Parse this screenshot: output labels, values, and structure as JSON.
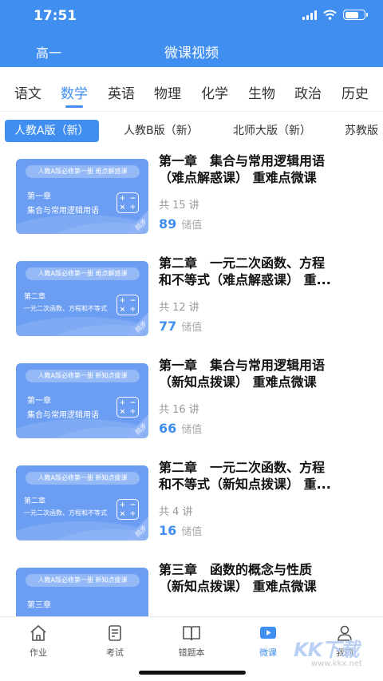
{
  "status": {
    "time": "17:51"
  },
  "header": {
    "grade": "高一",
    "title": "微课视频"
  },
  "subjects": [
    "语文",
    "数学",
    "英语",
    "物理",
    "化学",
    "生物",
    "政治",
    "历史"
  ],
  "active_subject": "数学",
  "editions": [
    "人教A版（新）",
    "人教B版（新）",
    "北师大版（新）",
    "苏教版"
  ],
  "active_edition": "人教A版（新）",
  "courses": [
    {
      "thumb_header": "人教A版必修第一册   难点解惑课",
      "thumb_chapter": "第一章",
      "thumb_topic": "集合与常用逻辑用语",
      "title_line1": "第一章　集合与常用逻辑用语",
      "title_line2": "（难点解惑课） 重难点微课",
      "count": "共 15 讲",
      "price": "89",
      "price_unit": "储值"
    },
    {
      "thumb_header": "人教A版必修第一册   难点解惑课",
      "thumb_chapter": "第二章",
      "thumb_topic": "一元二次函数、方程和不等式",
      "title_line1": "第二章　一元二次函数、方程",
      "title_line2": "和不等式（难点解惑课） 重...",
      "count": "共 12 讲",
      "price": "77",
      "price_unit": "储值"
    },
    {
      "thumb_header": "人教A版必修第一册   新知点拨课",
      "thumb_chapter": "第一章",
      "thumb_topic": "集合与常用逻辑用语",
      "title_line1": "第一章　集合与常用逻辑用语",
      "title_line2": "（新知点拨课） 重难点微课",
      "count": "共 16 讲",
      "price": "66",
      "price_unit": "储值"
    },
    {
      "thumb_header": "人教A版必修第一册   新知点拨课",
      "thumb_chapter": "第二章",
      "thumb_topic": "一元二次函数、方程和不等式",
      "title_line1": "第二章　一元二次函数、方程",
      "title_line2": "和不等式（新知点拨课） 重...",
      "count": "共 4 讲",
      "price": "16",
      "price_unit": "储值"
    },
    {
      "thumb_header": "人教A版必修第一册   新知点拨课",
      "thumb_chapter": "第三章",
      "thumb_topic": "",
      "title_line1": "第三章　函数的概念与性质",
      "title_line2": "（新知点拨课） 重难点微课",
      "count": "",
      "price": "",
      "price_unit": ""
    }
  ],
  "thumb_sync_label": "同步",
  "calc_symbols": [
    "+",
    "−",
    "×",
    "÷"
  ],
  "bottom_nav": [
    {
      "label": "作业",
      "icon": "home-icon"
    },
    {
      "label": "考试",
      "icon": "exam-icon"
    },
    {
      "label": "错题本",
      "icon": "notebook-icon"
    },
    {
      "label": "微课",
      "icon": "video-icon"
    },
    {
      "label": "我的",
      "icon": "profile-icon"
    }
  ],
  "active_nav": "微课",
  "watermark": {
    "logo": "KK下载",
    "url": "www.kkx.net"
  },
  "colors": {
    "accent": "#3f8ef0",
    "thumb_bg": "#6b9ef3"
  }
}
